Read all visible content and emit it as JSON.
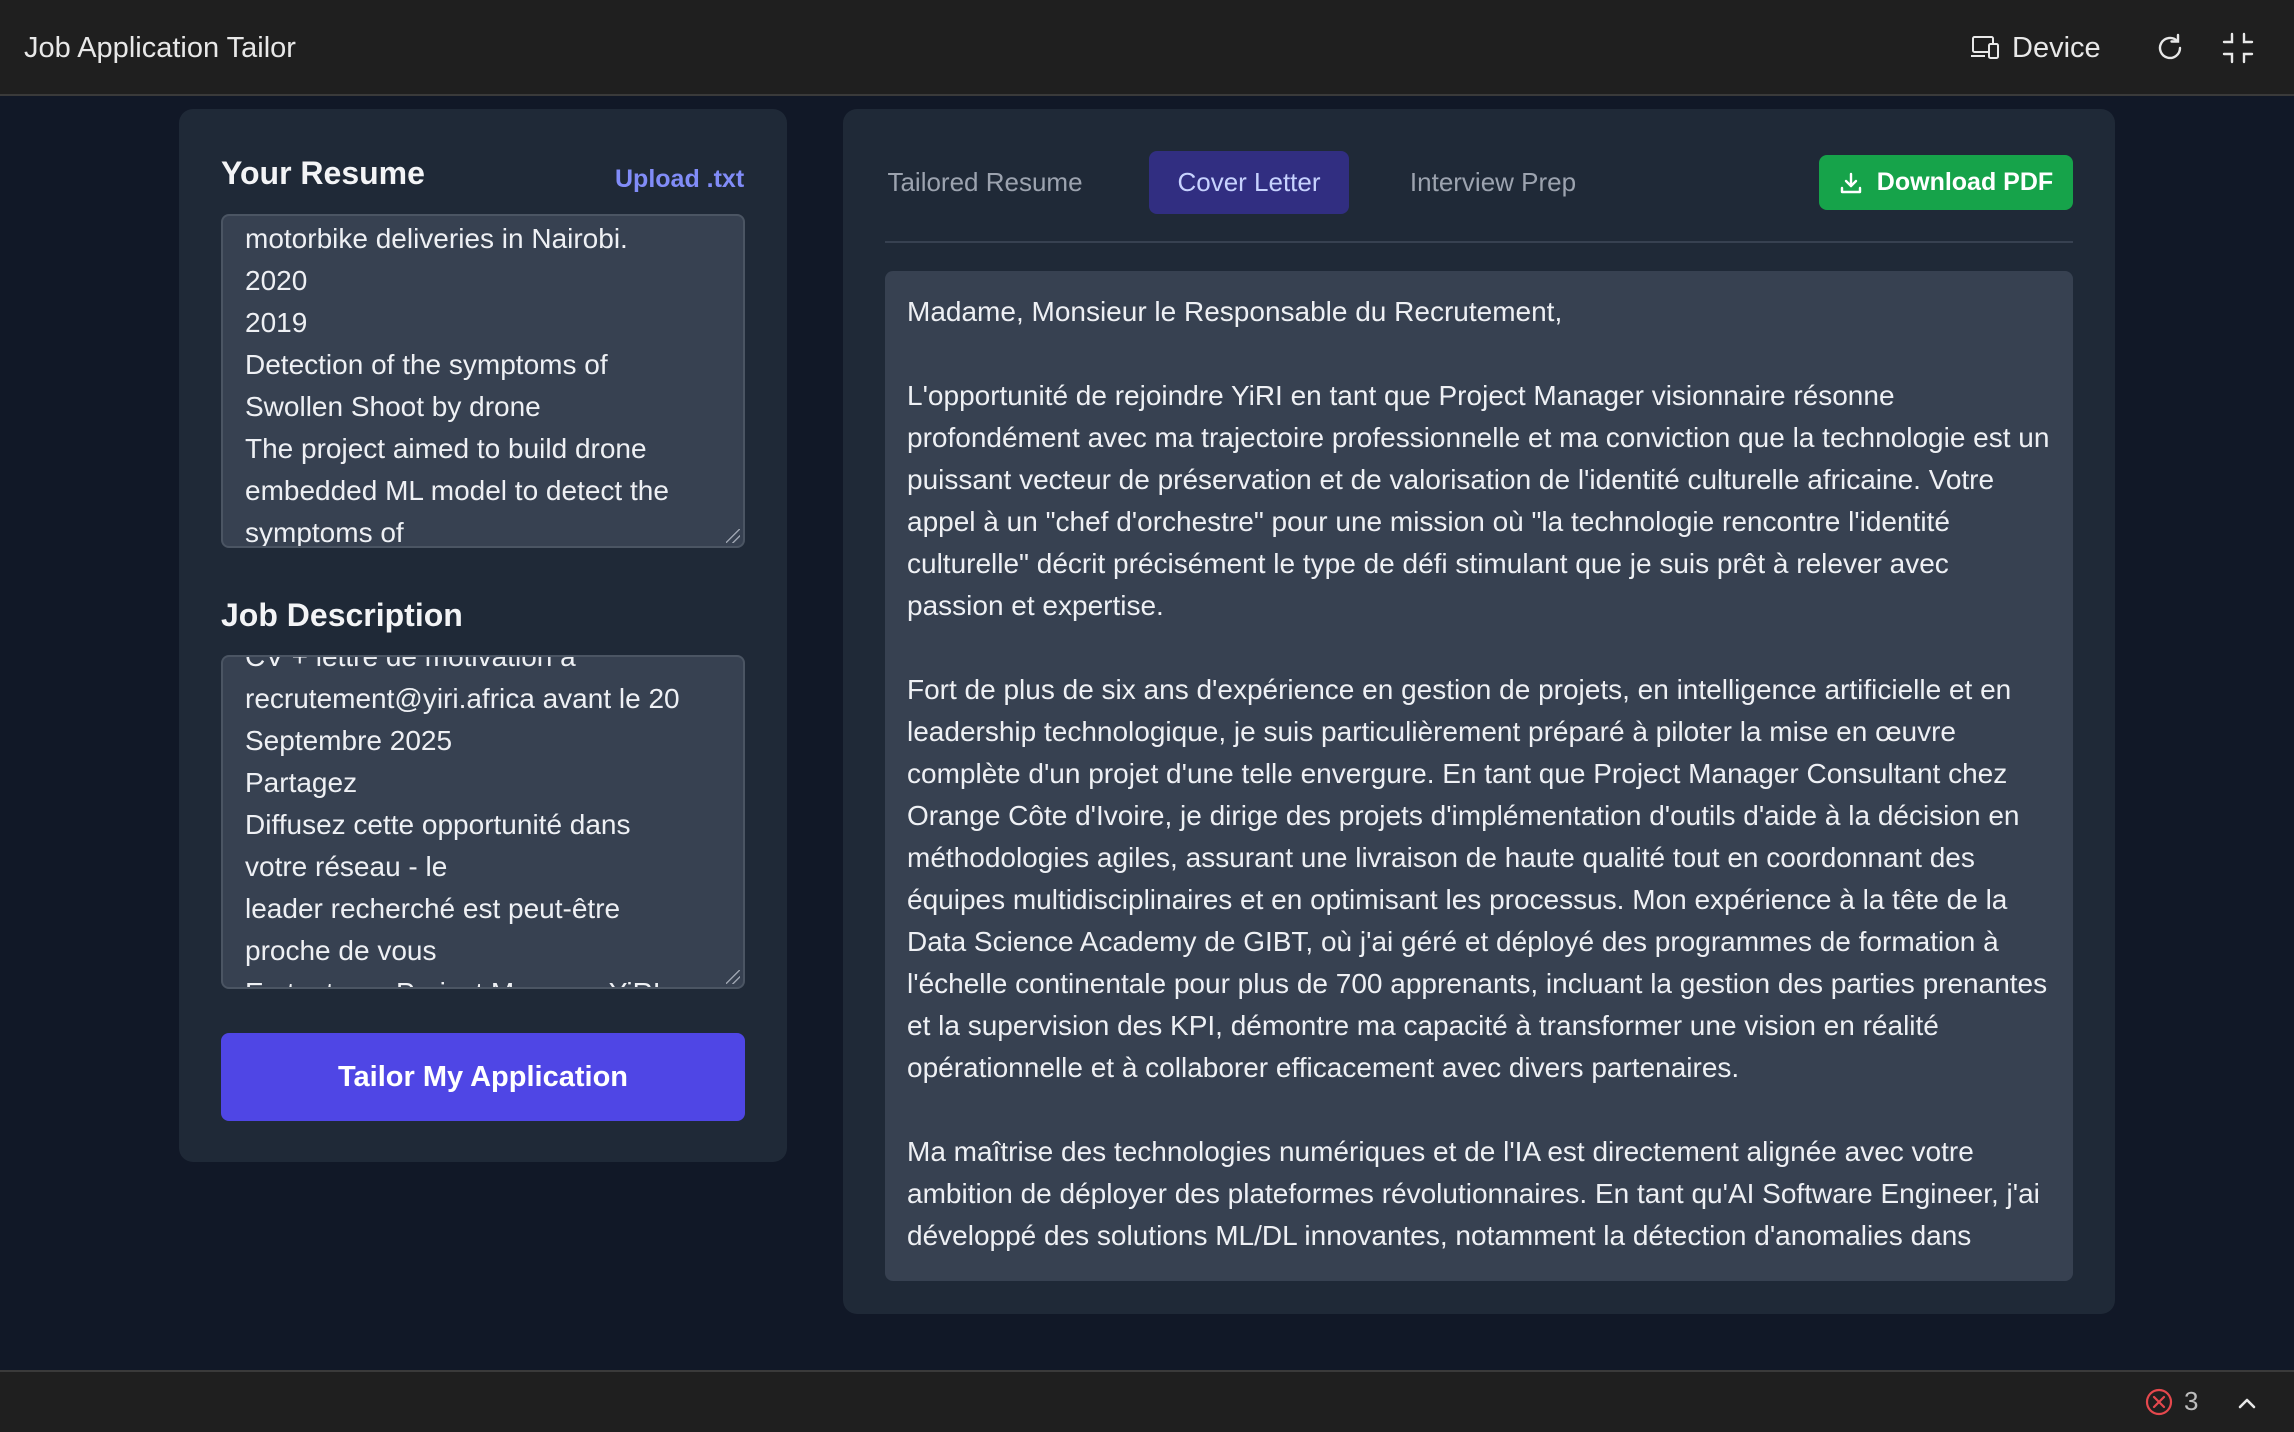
{
  "window": {
    "title": "Job Application Tailor",
    "device_label": "Device",
    "device_icon": "devices-icon",
    "refresh_icon": "refresh-icon",
    "collapse_icon": "collapse-icon"
  },
  "resume": {
    "label": "Your Resume",
    "upload_label": "Upload .txt",
    "text": "motorbike deliveries in Nairobi.\n2020\n2019\nDetection of the symptoms of\nSwollen Shoot by drone\nThe project aimed to build drone\nembedded ML model to detect the\nsymptoms of"
  },
  "job": {
    "label": "Job Description",
    "text": "CV + lettre de motivation à\nrecrutement@yiri.africa avant le 20\nSeptembre 2025\nPartagez\nDiffusez cette opportunité dans\nvotre réseau - le\nleader recherché est peut-être\nproche de vous\nEn tant que Project Manager YiRI"
  },
  "actions": {
    "tailor_label": "Tailor My Application",
    "download_label": "Download PDF"
  },
  "tabs": [
    {
      "label": "Tailored Resume",
      "active": false
    },
    {
      "label": "Cover Letter",
      "active": true
    },
    {
      "label": "Interview Prep",
      "active": false
    }
  ],
  "cover_letter": {
    "paragraphs": [
      "Madame, Monsieur le Responsable du Recrutement,",
      "L'opportunité de rejoindre YiRI en tant que Project Manager visionnaire résonne profondément avec ma trajectoire professionnelle et ma conviction que la technologie est un puissant vecteur de préservation et de valorisation de l'identité culturelle africaine. Votre appel à un \"chef d'orchestre\" pour une mission où \"la technologie rencontre l'identité culturelle\" décrit précisément le type de défi stimulant que je suis prêt à relever avec passion et expertise.",
      "Fort de plus de six ans d'expérience en gestion de projets, en intelligence artificielle et en leadership technologique, je suis particulièrement préparé à piloter la mise en œuvre complète d'un projet d'une telle envergure. En tant que Project Manager Consultant chez Orange Côte d'Ivoire, je dirige des projets d'implémentation d'outils d'aide à la décision en méthodologies agiles, assurant une livraison de haute qualité tout en coordonnant des équipes multidisciplinaires et en optimisant les processus. Mon expérience à la tête de la Data Science Academy de GIBT, où j'ai géré et déployé des programmes de formation à l'échelle continentale pour plus de 700 apprenants, incluant la gestion des parties prenantes et la supervision des KPI, démontre ma capacité à transformer une vision en réalité opérationnelle et à collaborer efficacement avec divers partenaires.",
      "Ma maîtrise des technologies numériques et de l'IA est directement alignée avec votre ambition de déployer des plateformes révolutionnaires. En tant qu'AI Software Engineer, j'ai développé des solutions ML/DL innovantes, notamment la détection d'anomalies dans"
    ]
  },
  "status": {
    "error_count": "3",
    "error_icon": "error-circle-icon",
    "chevron_icon": "chevron-up-icon",
    "accent_color": "#4f46e5",
    "download_color": "#16a34a"
  }
}
